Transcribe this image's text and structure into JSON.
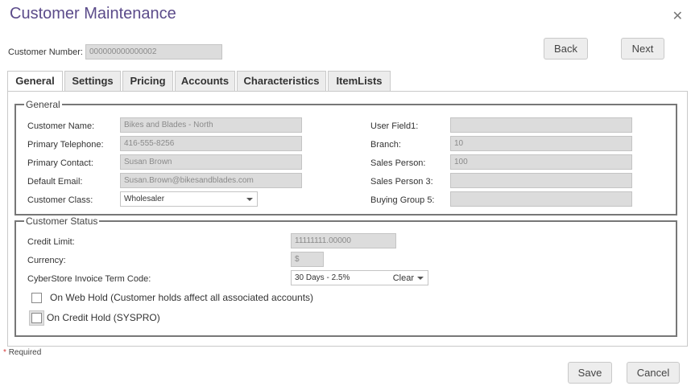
{
  "window": {
    "title": "Customer Maintenance",
    "close_glyph": "✕"
  },
  "customer_number": {
    "label": "Customer Number:",
    "value": "000000000000002"
  },
  "nav": {
    "back_label": "Back",
    "next_label": "Next"
  },
  "tabs": [
    "General",
    "Settings",
    "Pricing",
    "Accounts",
    "Characteristics",
    "ItemLists"
  ],
  "active_tab": "General",
  "general": {
    "legend": "General",
    "left_fields": [
      {
        "label": "Customer Name:",
        "value": "Bikes and Blades - North"
      },
      {
        "label": "Primary Telephone:",
        "value": "416-555-8256"
      },
      {
        "label": "Primary Contact:",
        "value": "Susan Brown"
      },
      {
        "label": "Default Email:",
        "value": "Susan.Brown@bikesandblades.com"
      },
      {
        "label": "Customer Class:",
        "value": "Wholesaler"
      }
    ],
    "right_fields": [
      {
        "label": "User Field1:",
        "value": ""
      },
      {
        "label": "Branch:",
        "value": "10"
      },
      {
        "label": "Sales Person:",
        "value": "100"
      },
      {
        "label": "Sales Person 3:",
        "value": ""
      },
      {
        "label": "Buying Group 5:",
        "value": ""
      }
    ]
  },
  "status": {
    "legend": "Customer Status",
    "credit_limit": {
      "label": "Credit Limit:",
      "value": "11111111.00000"
    },
    "currency": {
      "label": "Currency:",
      "value": "$"
    },
    "term_code": {
      "label": "CyberStore Invoice Term Code:",
      "value": "30 Days - 2.5%",
      "clear_label": "Clear"
    },
    "web_hold": {
      "label": "On Web Hold (Customer holds affect all associated accounts)",
      "checked": false
    },
    "credit_hold": {
      "label": "On Credit Hold (SYSPRO)",
      "checked": false
    }
  },
  "footer": {
    "required_star": "*",
    "required_label": "Required",
    "save_label": "Save",
    "cancel_label": "Cancel"
  },
  "colors": {
    "title": "#5b4b8a",
    "readonly_bg": "#dcdcdc",
    "required_star": "#d43b3b"
  }
}
